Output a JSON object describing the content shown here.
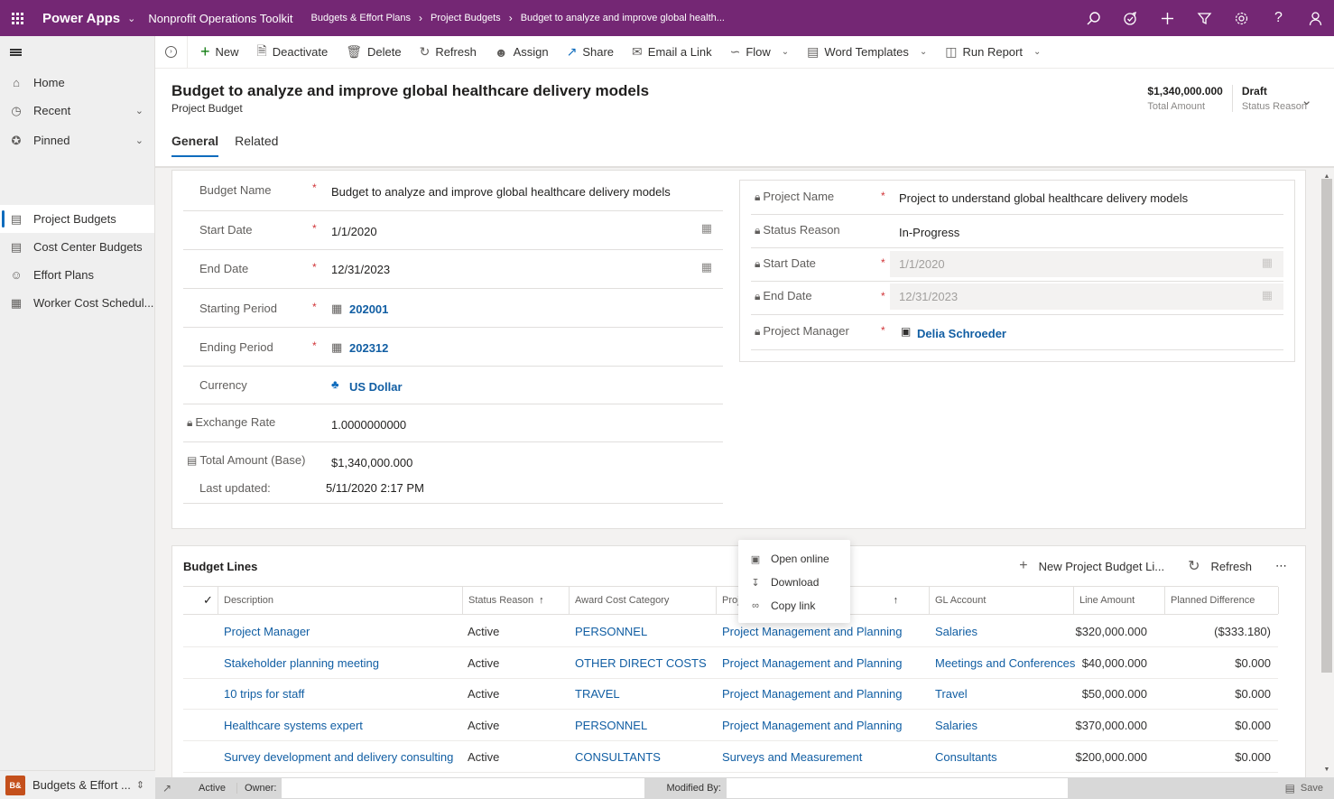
{
  "topbar": {
    "app_name": "Power Apps",
    "environment": "Nonprofit Operations Toolkit",
    "breadcrumb": [
      "Budgets & Effort Plans",
      "Project Budgets",
      "Budget to analyze and improve global health..."
    ],
    "icons": [
      "search-icon",
      "task-flow-icon",
      "plus-icon",
      "filter-icon",
      "settings-icon",
      "help-icon",
      "user-icon"
    ]
  },
  "sidebar": {
    "top_items": [
      {
        "label": "Home",
        "icon": "home-icon"
      },
      {
        "label": "Recent",
        "icon": "clock-icon",
        "expandable": true
      },
      {
        "label": "Pinned",
        "icon": "pin-icon",
        "expandable": true
      }
    ],
    "entity_items": [
      {
        "label": "Project Budgets",
        "icon": "entity-icon",
        "active": true
      },
      {
        "label": "Cost Center Budgets",
        "icon": "entity-icon"
      },
      {
        "label": "Effort Plans",
        "icon": "people-icon"
      },
      {
        "label": "Worker Cost Schedul...",
        "icon": "calendar-icon"
      }
    ],
    "area": {
      "badge": "B&",
      "label": "Budgets & Effort ..."
    }
  },
  "commandbar": {
    "new": "New",
    "deactivate": "Deactivate",
    "delete": "Delete",
    "refresh": "Refresh",
    "assign": "Assign",
    "share": "Share",
    "email_link": "Email a Link",
    "flow": "Flow",
    "word_templates": "Word Templates",
    "run_report": "Run Report"
  },
  "header": {
    "title": "Budget to analyze and improve global healthcare delivery models",
    "entity": "Project Budget",
    "tabs": [
      {
        "label": "General",
        "active": true
      },
      {
        "label": "Related"
      }
    ],
    "fields": [
      {
        "value": "$1,340,000.000",
        "label": "Total Amount"
      },
      {
        "value": "Draft",
        "label": "Status Reason"
      }
    ]
  },
  "budget_form": {
    "budget_name": {
      "label": "Budget Name",
      "value": "Budget to analyze and improve global healthcare delivery models"
    },
    "start_date": {
      "label": "Start Date",
      "value": "1/1/2020"
    },
    "end_date": {
      "label": "End Date",
      "value": "12/31/2023"
    },
    "starting_period": {
      "label": "Starting Period",
      "value": "202001"
    },
    "ending_period": {
      "label": "Ending Period",
      "value": "202312"
    },
    "currency": {
      "label": "Currency",
      "value": "US Dollar"
    },
    "exchange_rate": {
      "label": "Exchange Rate",
      "value": "1.0000000000"
    },
    "total_amount_base": {
      "label": "Total Amount (Base)",
      "value": "$1,340,000.000"
    },
    "last_updated": {
      "label": "Last updated:",
      "value": "5/11/2020 2:17 PM"
    }
  },
  "project_form": {
    "project_name": {
      "label": "Project Name",
      "value": "Project to understand global healthcare delivery models"
    },
    "status_reason": {
      "label": "Status Reason",
      "value": "In-Progress"
    },
    "start_date": {
      "label": "Start Date",
      "value": "1/1/2020"
    },
    "end_date": {
      "label": "End Date",
      "value": "12/31/2023"
    },
    "project_manager": {
      "label": "Project Manager",
      "value": "Delia Schroeder"
    }
  },
  "budget_lines": {
    "title": "Budget Lines",
    "new_label": "New Project Budget Li...",
    "refresh_label": "Refresh",
    "more_label": "⋯",
    "columns": [
      "Description",
      "Status Reason",
      "Award Cost Category",
      "Proj",
      "GL Account",
      "Line Amount",
      "Planned Difference"
    ],
    "rows": [
      {
        "description": "Project Manager",
        "status": "Active",
        "category": "PERSONNEL",
        "project_task": "Project Management and Planning",
        "gl_account": "Salaries",
        "line_amount": "$320,000.000",
        "planned_difference": "($333.180)"
      },
      {
        "description": "Stakeholder planning meeting",
        "status": "Active",
        "category": "OTHER DIRECT COSTS",
        "project_task": "Project Management and Planning",
        "gl_account": "Meetings and Conferences",
        "line_amount": "$40,000.000",
        "planned_difference": "$0.000"
      },
      {
        "description": "10 trips for staff",
        "status": "Active",
        "category": "TRAVEL",
        "project_task": "Project Management and Planning",
        "gl_account": "Travel",
        "line_amount": "$50,000.000",
        "planned_difference": "$0.000"
      },
      {
        "description": "Healthcare systems expert",
        "status": "Active",
        "category": "PERSONNEL",
        "project_task": "Project Management and Planning",
        "gl_account": "Salaries",
        "line_amount": "$370,000.000",
        "planned_difference": "$0.000"
      },
      {
        "description": "Survey development and delivery consulting",
        "status": "Active",
        "category": "CONSULTANTS",
        "project_task": "Surveys and Measurement",
        "gl_account": "Consultants",
        "line_amount": "$200,000.000",
        "planned_difference": "$0.000"
      }
    ]
  },
  "flyout": {
    "items": [
      {
        "label": "Open online",
        "icon": "open-online-icon"
      },
      {
        "label": "Download",
        "icon": "download-icon"
      },
      {
        "label": "Copy link",
        "icon": "link-icon"
      }
    ]
  },
  "statusbar": {
    "state": "Active",
    "owner_label": "Owner:",
    "owner_value": "",
    "modified_by_label": "Modified By:",
    "modified_by_value": "",
    "save_label": "Save"
  },
  "colors": {
    "brand": "#742774",
    "accent": "#0f6cbd",
    "link": "#115ea3",
    "required": "#d13438",
    "area_badge": "#c4501c"
  }
}
